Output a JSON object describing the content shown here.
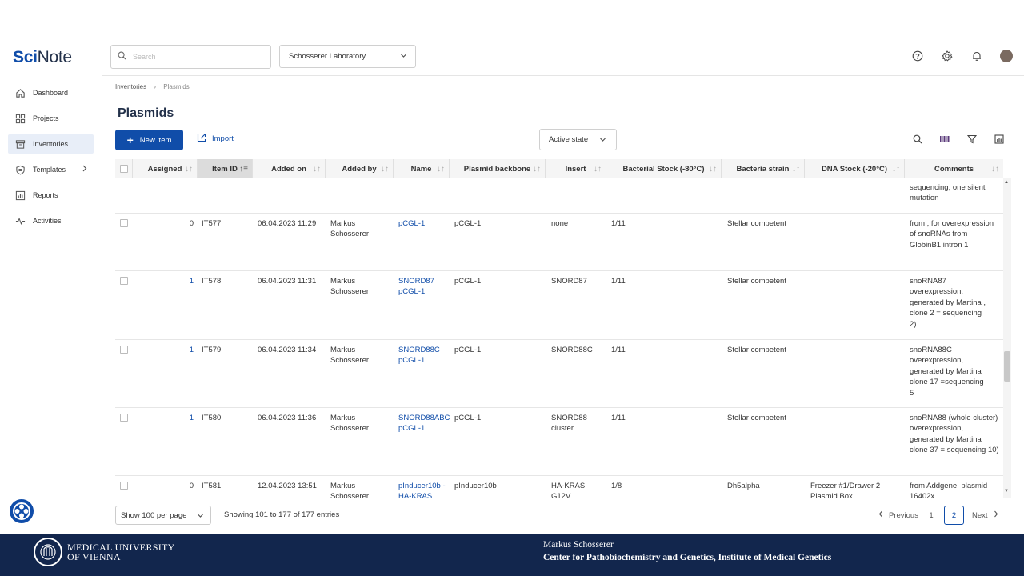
{
  "app": {
    "logo_part1": "Sci",
    "logo_part2": "Note"
  },
  "sidebar": {
    "items": [
      {
        "label": "Dashboard",
        "icon": "home-icon"
      },
      {
        "label": "Projects",
        "icon": "projects-icon"
      },
      {
        "label": "Inventories",
        "icon": "inventory-icon",
        "active": true
      },
      {
        "label": "Templates",
        "icon": "templates-icon"
      },
      {
        "label": "Reports",
        "icon": "reports-icon"
      },
      {
        "label": "Activities",
        "icon": "activities-icon"
      }
    ]
  },
  "topbar": {
    "search_placeholder": "Search",
    "team": "Schosserer Laboratory"
  },
  "breadcrumb": {
    "parent": "Inventories",
    "current": "Plasmids"
  },
  "page": {
    "title": "Plasmids",
    "new_item_label": "New item",
    "import_label": "Import",
    "state_filter": "Active state"
  },
  "table": {
    "columns": [
      "Assigned",
      "Item ID",
      "Added on",
      "Added by",
      "Name",
      "Plasmid backbone",
      "Insert",
      "Bacterial Stock (-80°C)",
      "Bacteria strain",
      "DNA Stock (-20°C)",
      "Comments"
    ],
    "partial_top_comment": "sequencing, one silent mutation",
    "rows": [
      {
        "assigned": "0",
        "id": "IT577",
        "added_on": "06.04.2023 11:29",
        "added_by": "Markus Schosserer",
        "name": "pCGL-1",
        "backbone": "pCGL-1",
        "insert": "none",
        "stock": "1/11",
        "strain": "Stellar competent",
        "dna": "",
        "comments": "from , for overexpression of snoRNAs from GlobinB1 intron 1"
      },
      {
        "assigned": "1",
        "id": "IT578",
        "added_on": "06.04.2023 11:31",
        "added_by": "Markus Schosserer",
        "name": "SNORD87 pCGL-1",
        "backbone": "pCGL-1",
        "insert": "SNORD87",
        "stock": "1/11",
        "strain": "Stellar competent",
        "dna": "",
        "comments": "snoRNA87 overexpression, generated by Martina , clone 2 = sequencing 2)"
      },
      {
        "assigned": "1",
        "id": "IT579",
        "added_on": "06.04.2023 11:34",
        "added_by": "Markus Schosserer",
        "name": "SNORD88C pCGL-1",
        "backbone": "pCGL-1",
        "insert": "SNORD88C",
        "stock": "1/11",
        "strain": "Stellar competent",
        "dna": "",
        "comments": "snoRNA88C overexpression, generated by Martina clone 17 =sequencing 5"
      },
      {
        "assigned": "1",
        "id": "IT580",
        "added_on": "06.04.2023 11:36",
        "added_by": "Markus Schosserer",
        "name": "SNORD88ABC pCGL-1",
        "backbone": "pCGL-1",
        "insert": "SNORD88 cluster",
        "stock": "1/11",
        "strain": "Stellar competent",
        "dna": "",
        "comments": "snoRNA88 (whole cluster) overexpression, generated by Martina clone 37 = sequencing 10)"
      },
      {
        "assigned": "0",
        "id": "IT581",
        "added_on": "12.04.2023 13:51",
        "added_by": "Markus Schosserer",
        "name": "pInducer10b -HA-KRAS",
        "backbone": "pInducer10b",
        "insert": "HA-KRAS G12V",
        "stock": "1/8",
        "strain": "Dh5alpha",
        "dna": "Freezer #1/Drawer 2 Plasmid Box",
        "comments": "from Addgene, plasmid 16402x"
      }
    ]
  },
  "footer": {
    "per_page": "Show 100 per page",
    "showing": "Showing 101 to 177 of 177 entries",
    "previous": "Previous",
    "page1": "1",
    "page2": "2",
    "next": "Next"
  },
  "banner": {
    "university_line1": "MEDICAL UNIVERSITY",
    "university_line2": "OF VIENNA",
    "presenter": "Markus Schosserer",
    "institute": "Center for Pathobiochemistry and Genetics, Institute of Medical Genetics"
  },
  "colors": {
    "brand": "#104da9",
    "banner": "#12264d"
  }
}
